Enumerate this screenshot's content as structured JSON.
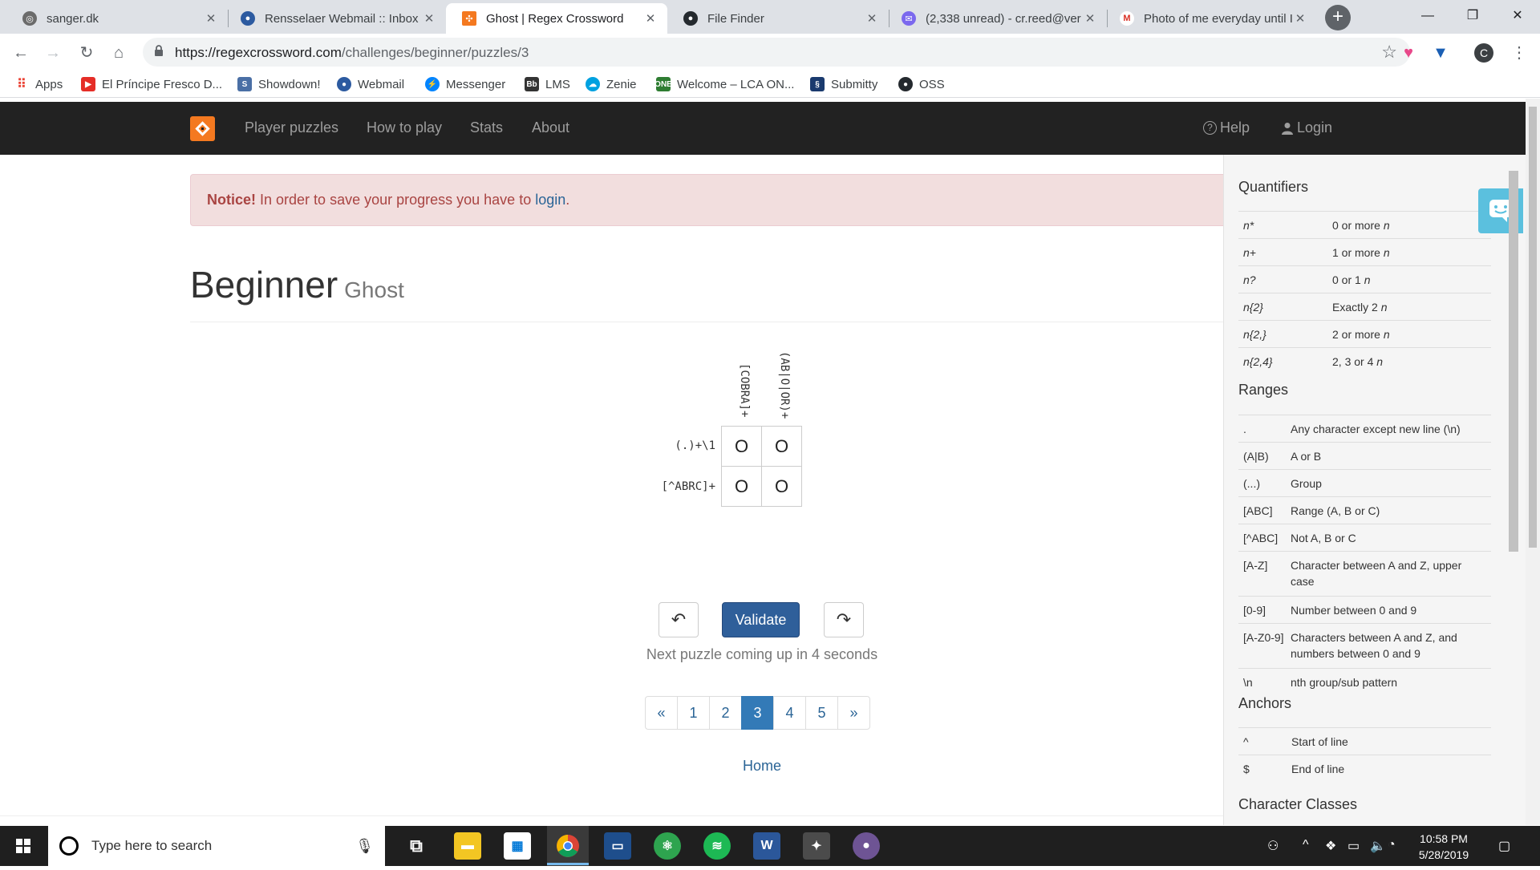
{
  "browser": {
    "tabs": [
      {
        "title": "sanger.dk"
      },
      {
        "title": "Rensselaer Webmail :: Inbox"
      },
      {
        "title": "Ghost | Regex Crossword"
      },
      {
        "title": "File Finder"
      },
      {
        "title": "(2,338 unread) - cr.reed@ver"
      },
      {
        "title": "Photo of me everyday until I"
      }
    ],
    "url_host": "https://regexcrossword.com",
    "url_path": "/challenges/beginner/puzzles/3",
    "profile_initial": "C",
    "bookmarks": [
      "Apps",
      "El Príncipe Fresco D...",
      "Showdown!",
      "Webmail",
      "Messenger",
      "LMS",
      "Zenie",
      "Welcome – LCA ON...",
      "Submitty",
      "OSS"
    ]
  },
  "site": {
    "nav": {
      "links": [
        "Player puzzles",
        "How to play",
        "Stats",
        "About"
      ],
      "help": "Help",
      "login": "Login"
    },
    "notice": {
      "strong": "Notice!",
      "text": " In order to save your progress you have to ",
      "link": "login",
      "end": "."
    },
    "title": "Beginner",
    "subtitle": "Ghost",
    "puzzle": {
      "col_clues": [
        "[COBRA]+",
        "(AB|O|OR)+"
      ],
      "row_clues": [
        "(.)+\\1",
        "[^ABRC]+"
      ],
      "cells": [
        "O",
        "O",
        "O",
        "O"
      ]
    },
    "validate_label": "Validate",
    "next_message": "Next puzzle coming up in 4 seconds",
    "pagination": [
      "«",
      "1",
      "2",
      "3",
      "4",
      "5",
      "»"
    ],
    "active_page": "3",
    "home_link": "Home"
  },
  "cheatsheet": {
    "quantifiers_title": "Quantifiers",
    "quantifiers": [
      {
        "k": "n*",
        "v": "0 or more ",
        "n": "n"
      },
      {
        "k": "n+",
        "v": "1 or more ",
        "n": "n"
      },
      {
        "k": "n?",
        "v": "0 or 1 ",
        "n": "n"
      },
      {
        "k": "n{2}",
        "v": "Exactly 2 ",
        "n": "n"
      },
      {
        "k": "n{2,}",
        "v": "2 or more ",
        "n": "n"
      },
      {
        "k": "n{2,4}",
        "v": "2, 3 or 4 ",
        "n": "n"
      }
    ],
    "ranges_title": "Ranges",
    "ranges": [
      {
        "k": ".",
        "v": "Any character except new line (\\n)"
      },
      {
        "k": "(A|B)",
        "v": "A or B"
      },
      {
        "k": "(...)",
        "v": "Group"
      },
      {
        "k": "[ABC]",
        "v": "Range (A, B or C)"
      },
      {
        "k": "[^ABC]",
        "v": "Not A, B or C"
      },
      {
        "k": "[A-Z]",
        "v": "Character between A and Z, upper case"
      },
      {
        "k": "[0-9]",
        "v": "Number between 0 and 9"
      },
      {
        "k": "[A-Z0-9]",
        "v": "Characters between A and Z, and numbers between 0 and 9"
      },
      {
        "k": "\\n",
        "v": "nth group/sub pattern"
      }
    ],
    "anchors_title": "Anchors",
    "anchors": [
      {
        "k": "^",
        "v": "Start of line"
      },
      {
        "k": "$",
        "v": "End of line"
      }
    ],
    "classes_title": "Character Classes"
  },
  "taskbar": {
    "search_placeholder": "Type here to search",
    "time": "10:58 PM",
    "date": "5/28/2019"
  },
  "colors": {
    "nav_bg": "#222222",
    "accent": "#337ab7",
    "logo": "#f47920",
    "notice_bg": "#f2dede"
  }
}
